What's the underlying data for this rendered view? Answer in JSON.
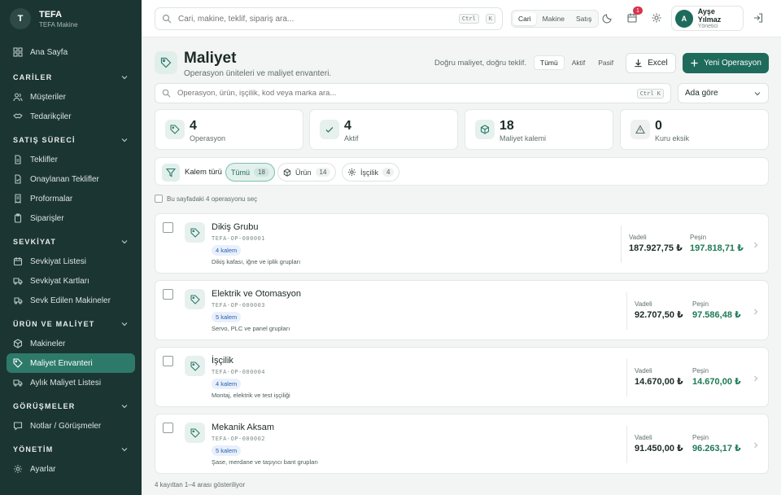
{
  "brand": {
    "logo": "T",
    "name": "TEFA",
    "sub": "TEFA Makine"
  },
  "sidebar": {
    "home": "Ana Sayfa",
    "sections": [
      {
        "title": "CARİLER",
        "items": [
          "Müşteriler",
          "Tedarikçiler"
        ]
      },
      {
        "title": "SATIŞ SÜRECİ",
        "items": [
          "Teklifler",
          "Onaylanan Teklifler",
          "Proformalar",
          "Siparişler"
        ]
      },
      {
        "title": "SEVKİYAT",
        "items": [
          "Sevkiyat Listesi",
          "Sevkiyat Kartları",
          "Sevk Edilen Makineler"
        ]
      },
      {
        "title": "ÜRÜN VE MALİYET",
        "items": [
          "Makineler",
          "Maliyet Envanteri",
          "Aylık Maliyet Listesi"
        ]
      },
      {
        "title": "GÖRÜŞMELER",
        "items": [
          "Notlar / Görüşmeler"
        ]
      },
      {
        "title": "YÖNETİM",
        "items": [
          "Ayarlar"
        ]
      }
    ]
  },
  "topbar": {
    "search_placeholder": "Cari, makine, teklif, sipariş ara...",
    "kbd1": "Ctrl",
    "kbd2": "K",
    "scope": [
      "Cari",
      "Makine",
      "Satış"
    ],
    "notif_count": "1",
    "user_initial": "A",
    "user_name": "Ayşe Yılmaz",
    "user_role": "Yönetici"
  },
  "header": {
    "title": "Maliyet",
    "subtitle": "Operasyon üniteleri ve maliyet envanteri.",
    "tagline": "Doğru maliyet, doğru teklif.",
    "status": [
      "Tümü",
      "Aktif",
      "Pasif"
    ],
    "excel": "Excel",
    "new": "Yeni Operasyon"
  },
  "search2": {
    "placeholder": "Operasyon, ürün, işçilik, kod veya marka ara...",
    "kbd": "Ctrl K",
    "sort": "Ada göre"
  },
  "stats": [
    {
      "value": "4",
      "label": "Operasyon"
    },
    {
      "value": "4",
      "label": "Aktif"
    },
    {
      "value": "18",
      "label": "Maliyet kalemi"
    },
    {
      "value": "0",
      "label": "Kuru eksik"
    }
  ],
  "filter": {
    "label": "Kalem türü",
    "chips": [
      {
        "label": "Tümü",
        "count": "18"
      },
      {
        "label": "Ürün",
        "count": "14"
      },
      {
        "label": "İşçilik",
        "count": "4"
      }
    ]
  },
  "select_all": "Bu sayfadaki 4 operasyonu seç",
  "price_labels": {
    "vadeli": "Vadeli",
    "pesin": "Peşin"
  },
  "operations": [
    {
      "name": "Dikiş Grubu",
      "code": "TEFA-OP-000001",
      "badge": "4 kalem",
      "desc": "Dikiş kafası, iğne ve iplik grupları",
      "vadeli": "187.927,75 ₺",
      "pesin": "197.818,71 ₺"
    },
    {
      "name": "Elektrik ve Otomasyon",
      "code": "TEFA-OP-000003",
      "badge": "5 kalem",
      "desc": "Servo, PLC ve panel grupları",
      "vadeli": "92.707,50 ₺",
      "pesin": "97.586,48 ₺"
    },
    {
      "name": "İşçilik",
      "code": "TEFA-OP-000004",
      "badge": "4 kalem",
      "desc": "Montaj, elektrik ve test işçiliği",
      "vadeli": "14.670,00 ₺",
      "pesin": "14.670,00 ₺"
    },
    {
      "name": "Mekanik Aksam",
      "code": "TEFA-OP-000002",
      "badge": "5 kalem",
      "desc": "Şase, merdane ve taşıyıcı bant grupları",
      "vadeli": "91.450,00 ₺",
      "pesin": "96.263,17 ₺"
    }
  ],
  "footer": "4 kayıttan 1–4 arası gösteriliyor",
  "colors": {
    "sidebar": "#1b3532",
    "accent": "#1e6b5c",
    "active": "#2d7a6b",
    "green_price": "#1e7a55",
    "badge_red": "#d8334a"
  }
}
